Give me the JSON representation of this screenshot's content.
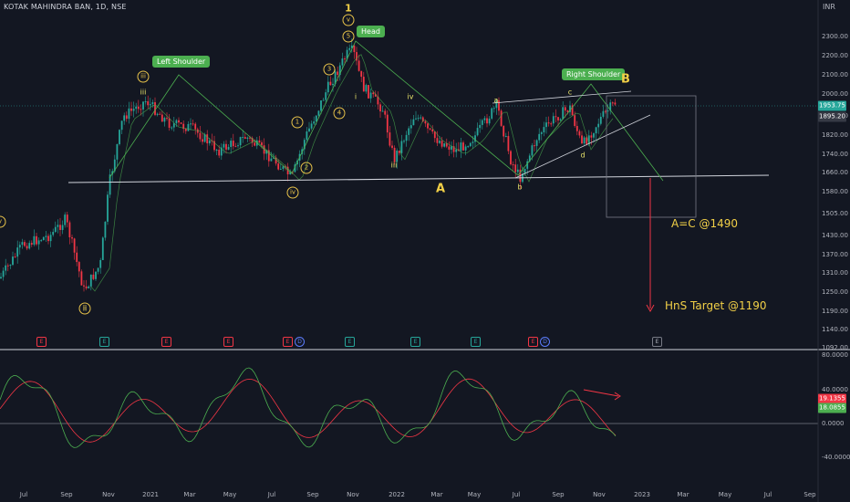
{
  "symbol_title": "KOTAK MAHINDRA BAN, 1D, NSE",
  "currency": "INR",
  "price_axis": [
    "2300.00",
    "2200.00",
    "2100.00",
    "2000.00",
    "1900.00",
    "1820.00",
    "1740.00",
    "1660.00",
    "1580.00",
    "1505.00",
    "1430.00",
    "1370.00",
    "1310.00",
    "1250.00",
    "1190.00",
    "1140.00",
    "1092.00"
  ],
  "osc_axis": [
    "80.0000",
    "40.0000",
    "0.0000",
    "-40.0000"
  ],
  "price_tags": {
    "last": "1953.75",
    "ref": "1895.20"
  },
  "osc_tags": {
    "fast": "19.1355",
    "slow": "18.0855"
  },
  "time_axis": [
    "Jul",
    "Sep",
    "Nov",
    "2021",
    "Mar",
    "May",
    "Jul",
    "Sep",
    "Nov",
    "2022",
    "Mar",
    "May",
    "Jul",
    "Sep",
    "Nov",
    "2023",
    "Mar",
    "May",
    "Jul",
    "Sep"
  ],
  "labels": {
    "left_shoulder": "Left Shoulder",
    "head": "Head",
    "right_shoulder": "Right Shoulder",
    "ac_target": "A=C @1490",
    "hns_target": "HnS Target @1190",
    "wave_1": "1",
    "wave_v": "v",
    "wave_B": "B",
    "wave_A": "A"
  },
  "wave_labels": [
    "iii",
    "ii",
    "i",
    "iii",
    "iv",
    "a",
    "b",
    "c",
    "d"
  ],
  "circled_labels": [
    "ii",
    "iv",
    "1",
    "2",
    "3",
    "4",
    "5",
    "iii",
    "v"
  ],
  "event_markers": [
    "E",
    "E",
    "E",
    "E",
    "E",
    "D",
    "E",
    "E",
    "E",
    "E",
    "D",
    "E"
  ],
  "colors": {
    "background": "#131722",
    "bull": "#26a69a",
    "bear": "#f23645",
    "osc_fast": "#4caf50",
    "osc_slow": "#f23645",
    "annotation": "#e8e36b",
    "target": "#f23645"
  }
}
